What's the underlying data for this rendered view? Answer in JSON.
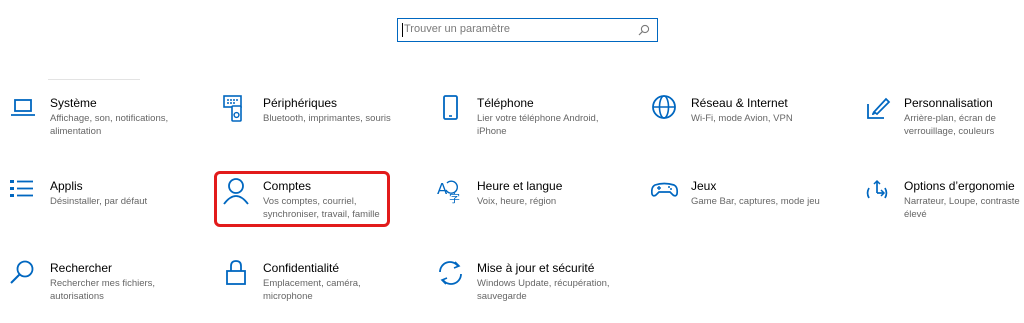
{
  "search": {
    "placeholder": "Trouver un paramètre"
  },
  "accent_color": "#0067c0",
  "highlight_color": "#e21b1b",
  "tiles": [
    {
      "title": "Système",
      "desc": "Affichage, son, notifications, alimentation",
      "icon": "laptop-icon"
    },
    {
      "title": "Périphériques",
      "desc": "Bluetooth, imprimantes, souris",
      "icon": "devices-icon"
    },
    {
      "title": "Téléphone",
      "desc": "Lier votre téléphone Android, iPhone",
      "icon": "phone-icon"
    },
    {
      "title": "Réseau & Internet",
      "desc": "Wi-Fi, mode Avion, VPN",
      "icon": "globe-icon"
    },
    {
      "title": "Personnalisation",
      "desc": "Arrière-plan, écran de verrouillage, couleurs",
      "icon": "paintbrush-icon"
    },
    {
      "title": "Applis",
      "desc": "Désinstaller, par défaut",
      "icon": "apps-list-icon"
    },
    {
      "title": "Comptes",
      "desc": "Vos comptes, courriel, synchroniser, travail, famille",
      "icon": "person-icon"
    },
    {
      "title": "Heure et langue",
      "desc": "Voix, heure, région",
      "icon": "time-language-icon"
    },
    {
      "title": "Jeux",
      "desc": "Game Bar, captures, mode jeu",
      "icon": "gamepad-icon"
    },
    {
      "title": "Options d’ergonomie",
      "desc": "Narrateur, Loupe, contraste élevé",
      "icon": "ease-of-access-icon"
    },
    {
      "title": "Rechercher",
      "desc": "Rechercher mes fichiers, autorisations",
      "icon": "search-icon"
    },
    {
      "title": "Confidentialité",
      "desc": "Emplacement, caméra, microphone",
      "icon": "lock-icon"
    },
    {
      "title": "Mise à jour et sécurité",
      "desc": "Windows Update, récupération, sauvegarde",
      "icon": "sync-icon"
    }
  ]
}
